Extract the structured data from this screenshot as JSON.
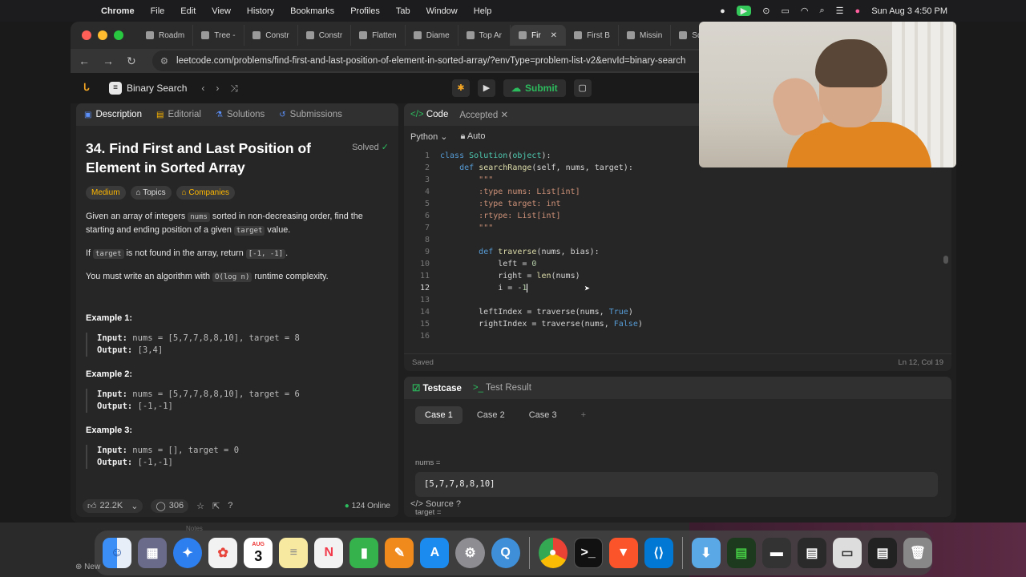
{
  "menubar": {
    "app": "Chrome",
    "items": [
      "File",
      "Edit",
      "View",
      "History",
      "Bookmarks",
      "Profiles",
      "Tab",
      "Window",
      "Help"
    ],
    "clock": "Sun Aug 3  4:50 PM"
  },
  "tabs": [
    {
      "label": "Roadm"
    },
    {
      "label": "Tree -"
    },
    {
      "label": "Constr"
    },
    {
      "label": "Constr"
    },
    {
      "label": "Flatten"
    },
    {
      "label": "Diame"
    },
    {
      "label": "Top Ar"
    },
    {
      "label": "Fir",
      "active": true
    },
    {
      "label": "First B"
    },
    {
      "label": "Missin"
    },
    {
      "label": "Sqrt(x"
    }
  ],
  "address": {
    "url": "leetcode.com/problems/find-first-and-last-position-of-element-in-sorted-array/?envType=problem-list-v2&envId=binary-search"
  },
  "header": {
    "problem_set": "Binary Search",
    "submit_label": "Submit"
  },
  "left": {
    "tabs": [
      "Description",
      "Editorial",
      "Solutions",
      "Submissions"
    ],
    "title": "34. Find First and Last Position of Element in Sorted Array",
    "solved": "Solved",
    "pills": [
      "Medium",
      "Topics",
      "Companies"
    ],
    "desc_p1a": "Given an array of integers ",
    "desc_p1_code1": "nums",
    "desc_p1b": " sorted in non-decreasing order, find the starting and ending position of a given ",
    "desc_p1_code2": "target",
    "desc_p1c": " value.",
    "desc_p2a": "If ",
    "desc_p2_code1": "target",
    "desc_p2b": " is not found in the array, return ",
    "desc_p2_code2": "[-1, -1]",
    "desc_p2c": ".",
    "desc_p3a": "You must write an algorithm with ",
    "desc_p3_code": "O(log n)",
    "desc_p3b": " runtime complexity.",
    "examples": [
      {
        "title": "Example 1:",
        "input_label": "Input:",
        "input": " nums = [5,7,7,8,8,10], target = 8",
        "output_label": "Output:",
        "output": " [3,4]"
      },
      {
        "title": "Example 2:",
        "input_label": "Input:",
        "input": " nums = [5,7,7,8,8,10], target = 6",
        "output_label": "Output:",
        "output": " [-1,-1]"
      },
      {
        "title": "Example 3:",
        "input_label": "Input:",
        "input": " nums = [], target = 0",
        "output_label": "Output:",
        "output": " [-1,-1]"
      }
    ],
    "likes": "22.2K",
    "comments": "306",
    "online": "124 Online"
  },
  "code": {
    "tabs": [
      "Code",
      "Accepted"
    ],
    "language": "Python",
    "mode": "Auto",
    "status_left": "Saved",
    "status_right": "Ln 12, Col 19",
    "line_numbers": [
      "1",
      "2",
      "3",
      "4",
      "5",
      "6",
      "7",
      "8",
      "9",
      "10",
      "11",
      "12",
      "13",
      "14",
      "15",
      "16"
    ],
    "current_line": 12
  },
  "testcase": {
    "tabs": [
      "Testcase",
      "Test Result"
    ],
    "cases": [
      "Case 1",
      "Case 2",
      "Case 3"
    ],
    "add": "+",
    "var1_label": "nums =",
    "var1_value": "[5,7,7,8,8,10]",
    "var2_label": "target =",
    "source": "Source"
  },
  "dock": {
    "calendar_month": "AUG",
    "calendar_day": "3",
    "new_label": "New",
    "notes_label": "Notes"
  },
  "colors": {
    "accent_green": "#2cbb5d",
    "medium_yellow": "#ffb800",
    "tab_blue": "#5b8ff9"
  }
}
